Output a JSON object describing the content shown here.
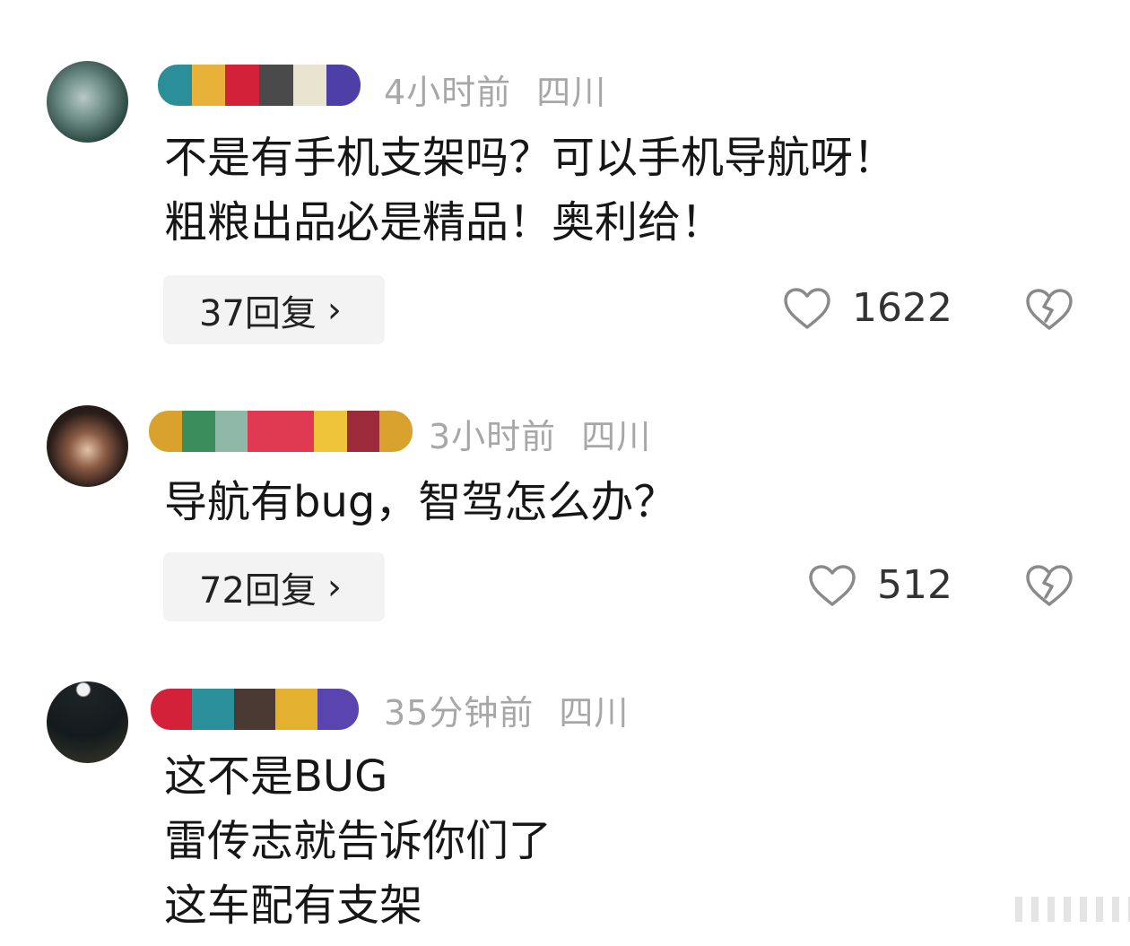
{
  "comments": [
    {
      "time": "4小时前",
      "location": "四川",
      "text": "不是有手机支架吗？可以手机导航呀！\n粗粮出品必是精品！奥利给！",
      "replies_label": "37回复",
      "likes": "1622"
    },
    {
      "time": "3小时前",
      "location": "四川",
      "text": "导航有bug，智驾怎么办？",
      "replies_label": "72回复",
      "likes": "512"
    },
    {
      "time": "35分钟前",
      "location": "四川",
      "text": "这不是BUG\n雷传志就告诉你们了\n这车配有支架"
    }
  ],
  "icons": {
    "like": "heart-outline-icon",
    "dislike": "broken-heart-icon",
    "chevron": "chevron-right-icon"
  },
  "colors": {
    "meta_gray": "#a7a7a7",
    "reply_bg": "#f3f3f3",
    "icon_gray": "#8a8a8a"
  }
}
